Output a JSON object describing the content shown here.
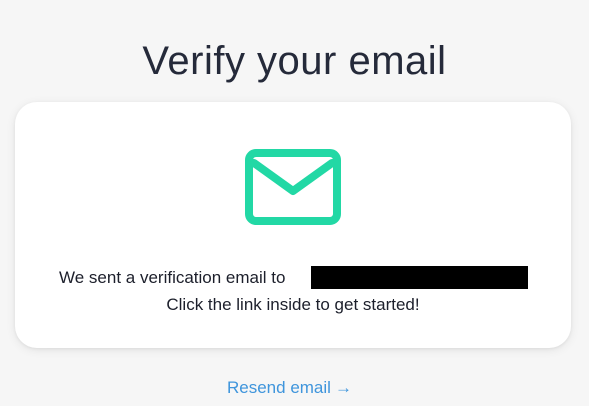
{
  "page": {
    "title": "Verify your email"
  },
  "card": {
    "icon": "envelope-icon",
    "icon_color": "#22d8a5",
    "message_line1": "We sent a verification email to",
    "message_line2": "Click the link inside to get started!"
  },
  "actions": {
    "resend_label": "Resend email",
    "resend_arrow": "→",
    "link_color": "#3f95dc"
  }
}
